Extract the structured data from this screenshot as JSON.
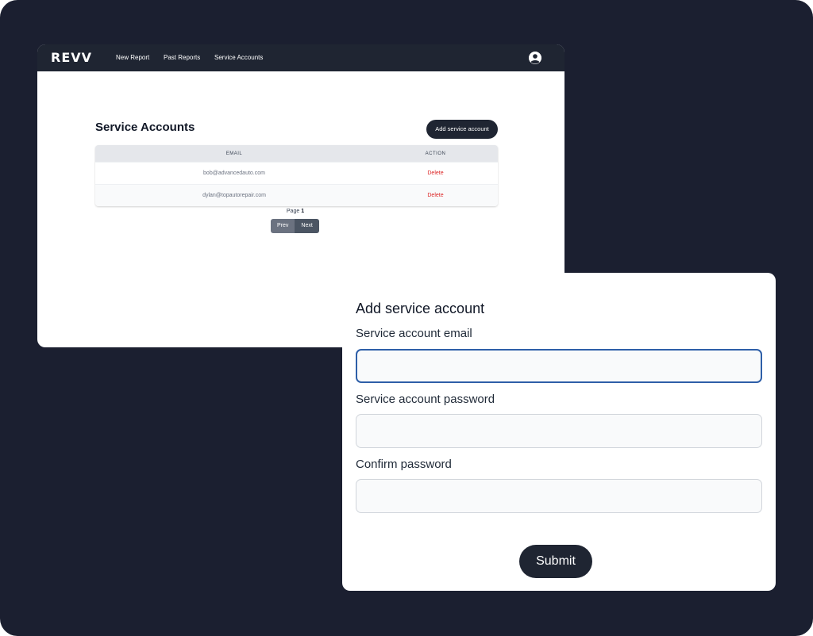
{
  "app": {
    "logo_text": "REVV",
    "nav": [
      {
        "label": "New Report"
      },
      {
        "label": "Past Reports"
      },
      {
        "label": "Service Accounts"
      }
    ],
    "user_icon": "user-circle-icon"
  },
  "page": {
    "title": "Service Accounts",
    "add_button_label": "Add service account"
  },
  "table": {
    "columns": [
      "EMAIL",
      "ACTION"
    ],
    "rows": [
      {
        "email": "bob@advancedauto.com",
        "action": "Delete"
      },
      {
        "email": "dylan@topautorepair.com",
        "action": "Delete"
      }
    ]
  },
  "pagination": {
    "page_label": "Page",
    "page_number": "1",
    "prev_label": "Prev",
    "next_label": "Next"
  },
  "modal": {
    "title": "Add service account",
    "fields": [
      {
        "label": "Service account email",
        "value": "",
        "placeholder": ""
      },
      {
        "label": "Service account password",
        "value": "",
        "placeholder": ""
      },
      {
        "label": "Confirm password",
        "value": "",
        "placeholder": ""
      }
    ],
    "submit_label": "Submit"
  },
  "colors": {
    "backdrop": "#1b1f30",
    "navbar": "#1f2532",
    "primary_button": "#1f2532",
    "delete_text": "#dc2626",
    "focus_border": "#2e5fa8"
  }
}
